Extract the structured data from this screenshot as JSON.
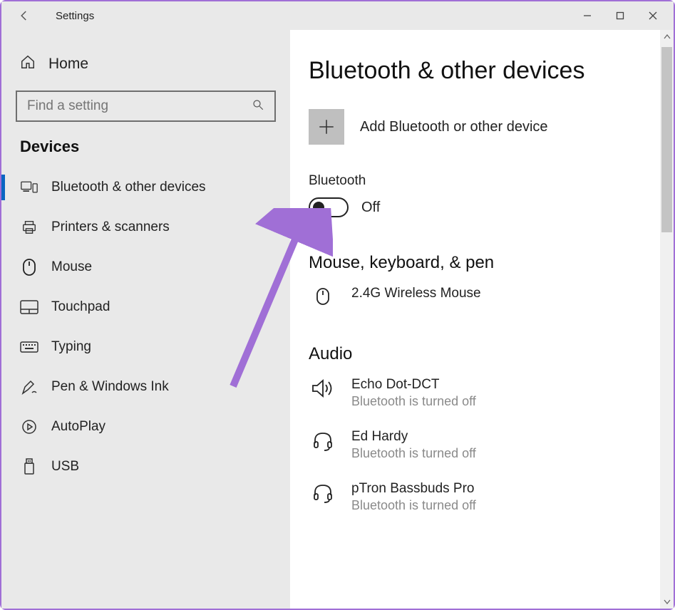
{
  "window": {
    "title": "Settings"
  },
  "sidebar": {
    "home": "Home",
    "search_placeholder": "Find a setting",
    "section": "Devices",
    "items": [
      {
        "label": "Bluetooth & other devices",
        "icon": "bluetooth-devices-icon",
        "active": true
      },
      {
        "label": "Printers & scanners",
        "icon": "printer-icon"
      },
      {
        "label": "Mouse",
        "icon": "mouse-icon"
      },
      {
        "label": "Touchpad",
        "icon": "touchpad-icon"
      },
      {
        "label": "Typing",
        "icon": "keyboard-icon"
      },
      {
        "label": "Pen & Windows Ink",
        "icon": "pen-icon"
      },
      {
        "label": "AutoPlay",
        "icon": "autoplay-icon"
      },
      {
        "label": "USB",
        "icon": "usb-icon"
      }
    ]
  },
  "page": {
    "title": "Bluetooth & other devices",
    "add_label": "Add Bluetooth or other device",
    "bluetooth_heading": "Bluetooth",
    "bluetooth_state": "Off",
    "sections": [
      {
        "title": "Mouse, keyboard, & pen",
        "devices": [
          {
            "name": "2.4G Wireless Mouse",
            "sub": "",
            "icon": "mouse-icon"
          }
        ]
      },
      {
        "title": "Audio",
        "devices": [
          {
            "name": "Echo Dot-DCT",
            "sub": "Bluetooth is turned off",
            "icon": "speaker-icon"
          },
          {
            "name": "Ed Hardy",
            "sub": "Bluetooth is turned off",
            "icon": "headset-icon"
          },
          {
            "name": "pTron Bassbuds Pro",
            "sub": "Bluetooth is turned off",
            "icon": "headset-icon"
          }
        ]
      }
    ]
  },
  "annotation": {
    "arrow_color": "#a06fd6"
  }
}
